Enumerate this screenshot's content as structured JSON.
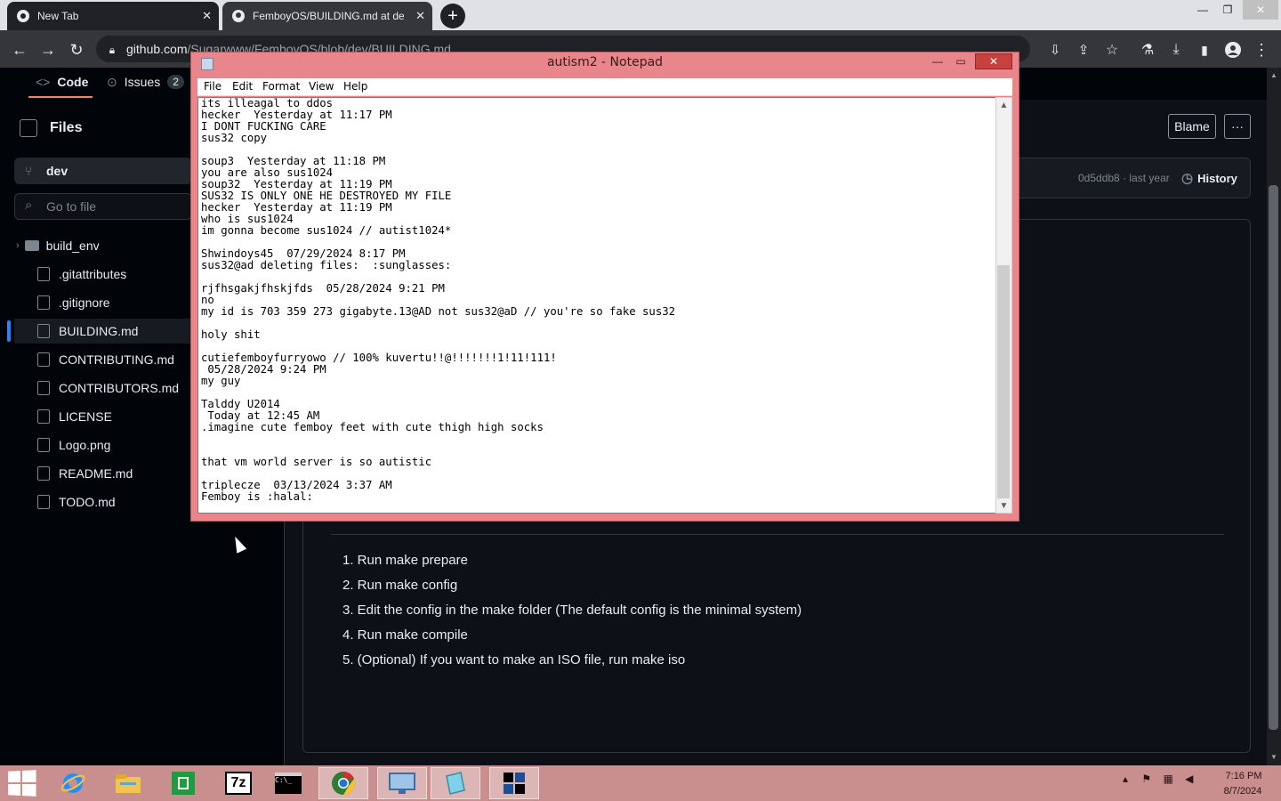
{
  "browser": {
    "tabs": [
      {
        "title": "New Tab"
      },
      {
        "title": "FemboyOS/BUILDING.md at de"
      }
    ],
    "new_tab_symbol": "+",
    "close_symbol": "✕",
    "url_host": "github.com",
    "url_path": "/Sugarwww/FemboyOS/blob/dev/BUILDING.md",
    "icons": [
      "back-icon",
      "forward-icon",
      "reload-icon",
      "lock-icon",
      "install-icon",
      "share-icon",
      "star-icon",
      "extension-icon",
      "download-icon",
      "sidepanel-icon",
      "profile-icon",
      "menu-icon"
    ]
  },
  "github": {
    "nav": {
      "code": "Code",
      "issues": "Issues",
      "issues_count": "2"
    },
    "sidebar": {
      "title": "Files",
      "branch": "dev",
      "search_placeholder": "Go to file",
      "items": [
        {
          "label": "build_env",
          "type": "folder"
        },
        {
          "label": ".gitattributes",
          "type": "file"
        },
        {
          "label": ".gitignore",
          "type": "file"
        },
        {
          "label": "BUILDING.md",
          "type": "file",
          "active": true
        },
        {
          "label": "CONTRIBUTING.md",
          "type": "file"
        },
        {
          "label": "CONTRIBUTORS.md",
          "type": "file"
        },
        {
          "label": "LICENSE",
          "type": "file"
        },
        {
          "label": "Logo.png",
          "type": "file"
        },
        {
          "label": "README.md",
          "type": "file"
        },
        {
          "label": "TODO.md",
          "type": "file"
        }
      ]
    },
    "header": {
      "blame": "Blame",
      "more": "···",
      "commit": "0d5ddb8 · last year",
      "history": "History"
    },
    "steps": [
      "1. Run make prepare",
      "2. Run make config",
      "3. Edit the config in the make folder (The default config is the minimal system)",
      "4. Run make compile",
      "5. (Optional) If you want to make an ISO file, run make iso"
    ]
  },
  "notepad": {
    "title": "autism2 - Notepad",
    "menu": [
      "File",
      "Edit",
      "Format",
      "View",
      "Help"
    ],
    "text": "its illeagal to ddos\nhecker  Yesterday at 11:17 PM\nI DONT FUCKING CARE\nsus32 copy\n\nsoup3  Yesterday at 11:18 PM\nyou are also sus1024\nsoup32  Yesterday at 11:19 PM\nSUS32 IS ONLY ONE HE DESTROYED MY FILE\nhecker  Yesterday at 11:19 PM\nwho is sus1024\nim gonna become sus1024 // autist1024*\n\nShwindoys45  07/29/2024 8:17 PM\nsus32@ad deleting files:  :sunglasses:\n\nrjfhsgakjfhskjfds  05/28/2024 9:21 PM\nno\nmy id is 703 359 273 gigabyte.13@AD not sus32@aD // you're so fake sus32\n\nholy shit\n\ncutiefemboyfurryowo // 100% kuvertu!!@!!!!!!!1!11!111!\n 05/28/2024 9:24 PM\nmy guy\n\nTalddy U2014\n Today at 12:45 AM\n.imagine cute femboy feet with cute thigh high socks\n\n\nthat vm world server is so autistic\n\ntriplecze  03/13/2024 3:37 AM\nFemboy is :halal:"
  },
  "taskbar": {
    "apps": [
      "internet-explorer-icon",
      "file-explorer-icon",
      "store-icon",
      "7zip-icon",
      "cmd-icon",
      "chrome-icon",
      "remote-desktop-icon",
      "notepad-icon",
      "app-icon"
    ],
    "seven_zip": "7z",
    "time": "7:16 PM",
    "date": "8/7/2024"
  },
  "colors": {
    "accent": "#f78166",
    "link": "#2f81f7",
    "notepad_frame": "#e8868b",
    "taskbar": "#c98e8e"
  }
}
